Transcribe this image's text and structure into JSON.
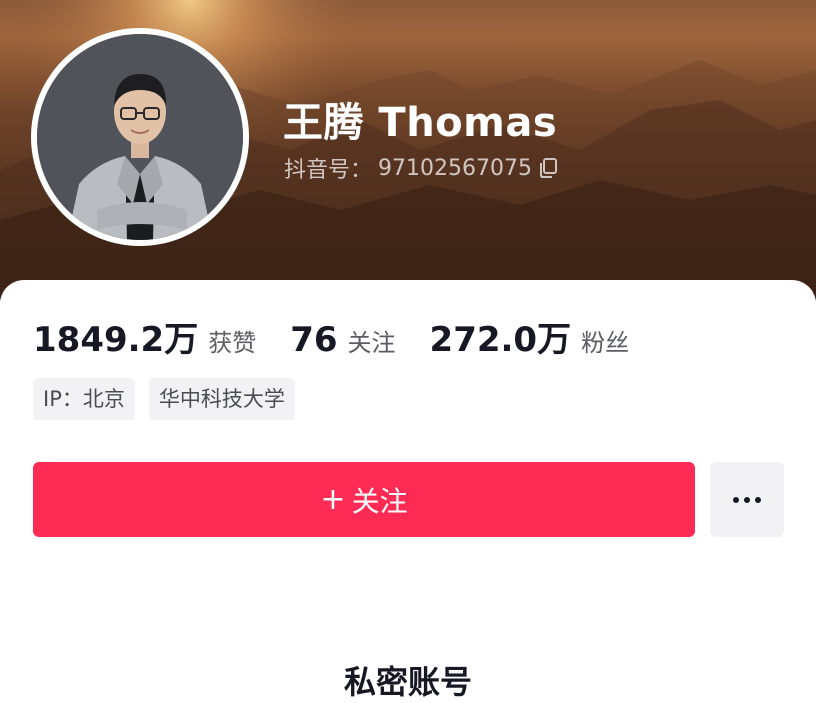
{
  "profile": {
    "name": "王腾 Thomas",
    "douyin_id_label": "抖音号：",
    "douyin_id": "97102567075"
  },
  "stats": [
    {
      "value": "1849.2万",
      "label": "获赞"
    },
    {
      "value": "76",
      "label": "关注"
    },
    {
      "value": "272.0万",
      "label": "粉丝"
    }
  ],
  "tags": [
    "IP：北京",
    "华中科技大学"
  ],
  "actions": {
    "follow_label": "关注",
    "follow_icon": "plus-icon",
    "more_icon": "more-dots-icon"
  },
  "private_notice": "私密账号",
  "colors": {
    "accent": "#fe2c55",
    "banner_dark": "#4a2c1b",
    "banner_light": "#a4693f"
  }
}
